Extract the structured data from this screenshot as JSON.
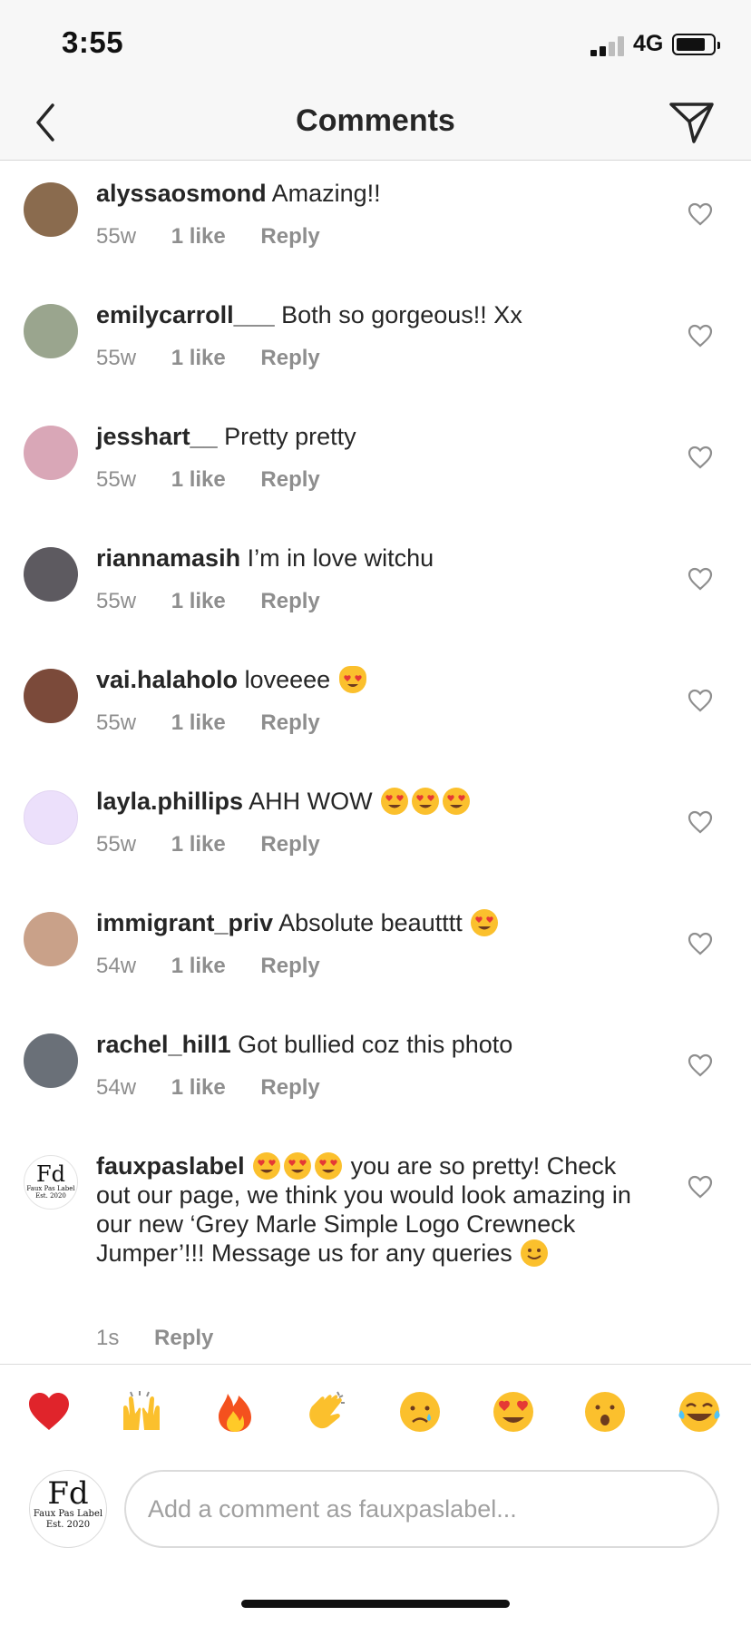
{
  "status_bar": {
    "time": "3:55",
    "network": "4G"
  },
  "header": {
    "title": "Comments"
  },
  "comments": [
    {
      "username": "alyssaosmond",
      "text": "Amazing!!",
      "age": "55w",
      "likes": "1 like",
      "reply": "Reply",
      "avatar_color": "#8a6b4e"
    },
    {
      "username": "emilycarroll___",
      "text": "Both so gorgeous!! Xx",
      "age": "55w",
      "likes": "1 like",
      "reply": "Reply",
      "avatar_color": "#9aa58e"
    },
    {
      "username": "jesshart__",
      "text": "Pretty pretty",
      "age": "55w",
      "likes": "1 like",
      "reply": "Reply",
      "avatar_color": "#d9a7b7"
    },
    {
      "username": "riannamasih",
      "text": "I’m in love witchu",
      "age": "55w",
      "likes": "1 like",
      "reply": "Reply",
      "avatar_color": "#5d5a60"
    },
    {
      "username": "vai.halaholo",
      "text": "loveeee",
      "age": "55w",
      "likes": "1 like",
      "reply": "Reply",
      "avatar_color": "#7b4a3a",
      "emoji": "cat-heart-eyes"
    },
    {
      "username": "layla.phillips",
      "text": "AHH WOW",
      "age": "55w",
      "likes": "1 like",
      "reply": "Reply",
      "avatar_color": "#ece0fb",
      "emoji": "heart-eyes-x3"
    },
    {
      "username": "immigrant_priv",
      "text": "Absolute beautttt",
      "age": "54w",
      "likes": "1 like",
      "reply": "Reply",
      "avatar_color": "#c9a189",
      "emoji": "heart-eyes"
    },
    {
      "username": "rachel_hill1",
      "text": "Got bullied coz this photo",
      "age": "54w",
      "likes": "1 like",
      "reply": "Reply",
      "avatar_color": "#6a7078"
    }
  ],
  "own_comment": {
    "username": "fauxpaslabel",
    "text_after_emoji": "you are so pretty! Check out our page, we think you would look amazing in our new ‘Grey Marle Simple Logo Crewneck Jumper’!!! Message us for any queries",
    "age": "1s",
    "reply": "Reply",
    "avatar": {
      "logo": "Fd",
      "line1": "Faux Pas Label",
      "line2": "Est. 2020"
    }
  },
  "reactions": [
    "red-heart",
    "raising-hands",
    "fire",
    "clapping-hands",
    "crying-face",
    "heart-eyes",
    "surprised-face",
    "tears-of-joy"
  ],
  "composer": {
    "placeholder": "Add a comment as fauxpaslabel...",
    "avatar": {
      "logo": "Fd",
      "line1": "Faux Pas Label",
      "line2": "Est. 2020"
    }
  },
  "colors": {
    "text": "#262626",
    "muted": "#8e8e8e",
    "divider": "#dbdbdb",
    "header_bg": "#f7f7f7"
  }
}
